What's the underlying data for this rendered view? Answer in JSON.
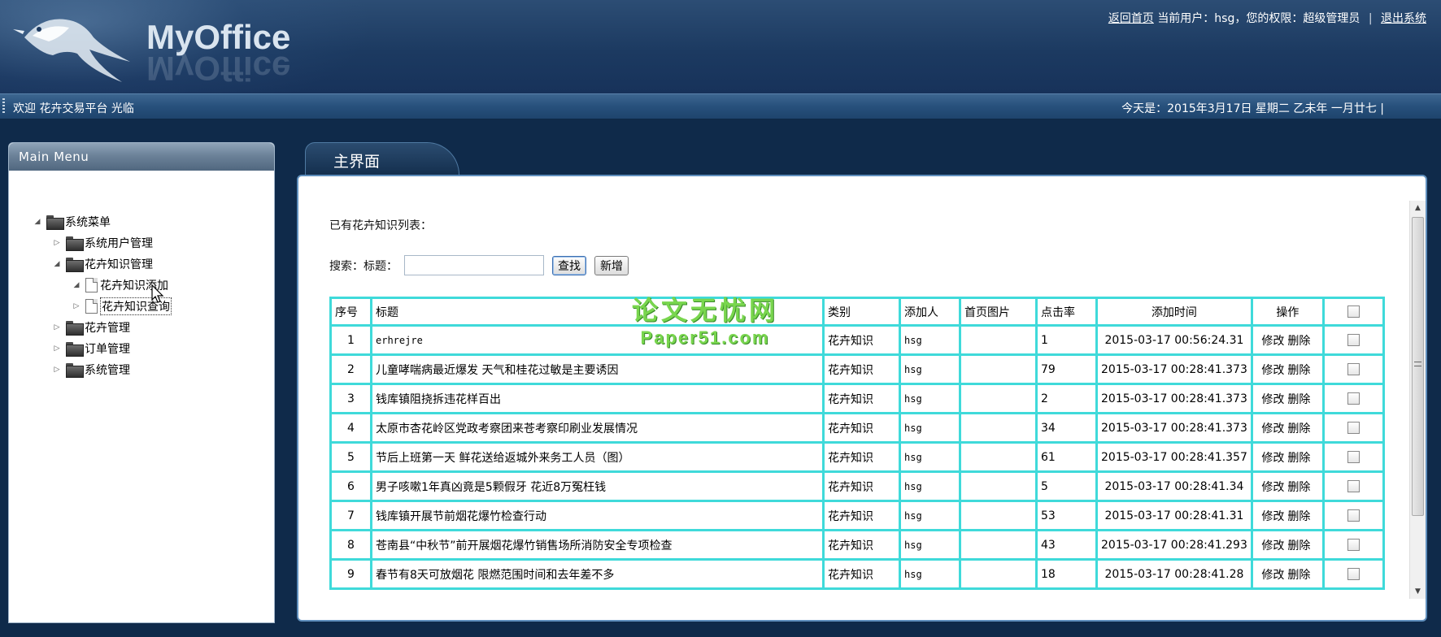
{
  "header": {
    "logo_text": "MyOffice",
    "links": {
      "home": "返回首页",
      "user_info": "当前用户：hsg，您的权限：超级管理员",
      "separator": "|",
      "logout": "退出系统"
    }
  },
  "welcome_bar": {
    "left_text": "欢迎 花卉交易平台 光临",
    "right_text": "今天是：2015年3月17日 星期二 乙未年 一月廿七 |"
  },
  "side_menu": {
    "title": "Main Menu",
    "root": "系统菜单",
    "items": [
      {
        "label": "系统用户管理"
      },
      {
        "label": "花卉知识管理"
      },
      {
        "label": "花卉知识添加"
      },
      {
        "label": "花卉知识查询"
      },
      {
        "label": "花卉管理"
      },
      {
        "label": "订单管理"
      },
      {
        "label": "系统管理"
      }
    ]
  },
  "main": {
    "tab_label": "主界面",
    "list_title": "已有花卉知识列表：",
    "search": {
      "label": "搜索：",
      "field_label": "标题：",
      "value": "",
      "search_button": "查找",
      "add_button": "新增"
    },
    "watermark": {
      "line1": "论文无忧网",
      "line2": "Paper51.com"
    },
    "table": {
      "headers": [
        "序号",
        "标题",
        "类别",
        "添加人",
        "首页图片",
        "点击率",
        "添加时间",
        "操作"
      ],
      "edit_label": "修改",
      "delete_label": "删除",
      "rows": [
        {
          "no": "1",
          "title": "erhrejre",
          "category": "花卉知识",
          "adder": "hsg",
          "image": "",
          "clicks": "1",
          "time": "2015-03-17 00:56:24.31"
        },
        {
          "no": "2",
          "title": "儿童哮喘病最近爆发 天气和桂花过敏是主要诱因",
          "category": "花卉知识",
          "adder": "hsg",
          "image": "",
          "clicks": "79",
          "time": "2015-03-17 00:28:41.373"
        },
        {
          "no": "3",
          "title": "钱库镇阻挠拆违花样百出",
          "category": "花卉知识",
          "adder": "hsg",
          "image": "",
          "clicks": "2",
          "time": "2015-03-17 00:28:41.373"
        },
        {
          "no": "4",
          "title": "太原市杏花岭区党政考察团来苍考察印刷业发展情况",
          "category": "花卉知识",
          "adder": "hsg",
          "image": "",
          "clicks": "34",
          "time": "2015-03-17 00:28:41.373"
        },
        {
          "no": "5",
          "title": "节后上班第一天 鲜花送给返城外来务工人员（图）",
          "category": "花卉知识",
          "adder": "hsg",
          "image": "",
          "clicks": "61",
          "time": "2015-03-17 00:28:41.357"
        },
        {
          "no": "6",
          "title": "男子咳嗽1年真凶竟是5颗假牙 花近8万冤枉钱",
          "category": "花卉知识",
          "adder": "hsg",
          "image": "",
          "clicks": "5",
          "time": "2015-03-17 00:28:41.34"
        },
        {
          "no": "7",
          "title": "钱库镇开展节前烟花爆竹检查行动",
          "category": "花卉知识",
          "adder": "hsg",
          "image": "",
          "clicks": "53",
          "time": "2015-03-17 00:28:41.31"
        },
        {
          "no": "8",
          "title": "苍南县“中秋节”前开展烟花爆竹销售场所消防安全专项检查",
          "category": "花卉知识",
          "adder": "hsg",
          "image": "",
          "clicks": "43",
          "time": "2015-03-17 00:28:41.293"
        },
        {
          "no": "9",
          "title": "春节有8天可放烟花 限燃范围时间和去年差不多",
          "category": "花卉知识",
          "adder": "hsg",
          "image": "",
          "clicks": "18",
          "time": "2015-03-17 00:28:41.28"
        }
      ]
    }
  }
}
